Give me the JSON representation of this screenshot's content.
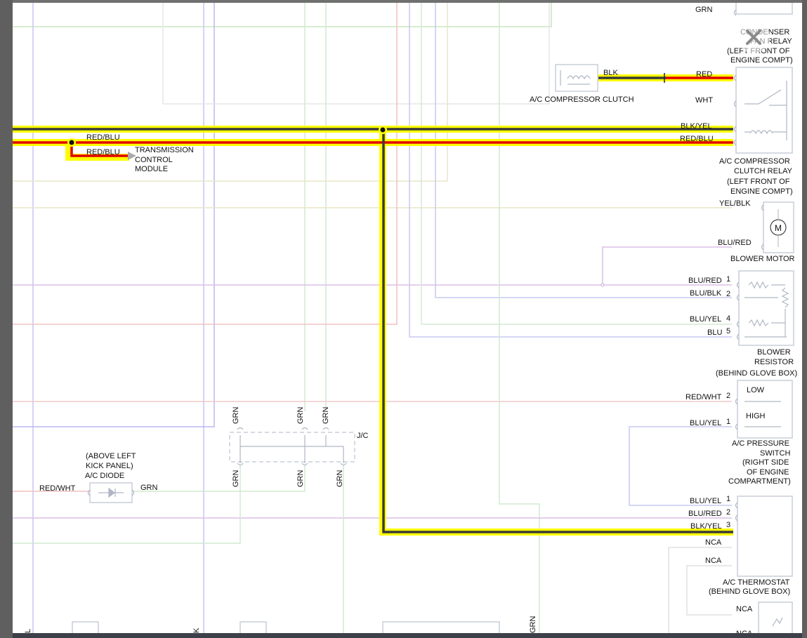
{
  "labels": {
    "grn_top": "GRN",
    "condenser_fan_relay": "CONDENSER",
    "condenser_fan_relay_2": "FAN RELAY",
    "condenser_loc_1": "(LEFT FRONT OF",
    "condenser_loc_2": "ENGINE COMPT)",
    "blk": "BLK",
    "red": "RED",
    "ac_compressor_clutch": "A/C COMPRESSOR CLUTCH",
    "wht": "WHT",
    "blk_yel_1": "BLK/YEL",
    "red_blu_1": "RED/BLU",
    "red_blu_left_1": "RED/BLU",
    "red_blu_left_2": "RED/BLU",
    "tcm_1": "TRANSMISSION",
    "tcm_2": "CONTROL",
    "tcm_3": "MODULE",
    "ac_clutch_relay_1": "A/C COMPRESSOR",
    "ac_clutch_relay_2": "CLUTCH RELAY",
    "ac_clutch_relay_3": "(LEFT FRONT OF",
    "ac_clutch_relay_4": "ENGINE COMPT)",
    "yel_blk": "YEL/BLK",
    "blu_red_motor": "BLU/RED",
    "blower_motor": "BLOWER MOTOR",
    "motor_m": "M",
    "res_blu_red": "BLU/RED",
    "res_blu_blk": "BLU/BLK",
    "res_blu_yel": "BLU/YEL",
    "res_blu": "BLU",
    "pin_1": "1",
    "pin_2": "2",
    "pin_4": "4",
    "pin_5": "5",
    "blower_resistor_1": "BLOWER",
    "blower_resistor_2": "RESISTOR",
    "blower_resistor_3": "(BEHIND GLOVE BOX)",
    "low": "LOW",
    "high": "HIGH",
    "ps_red_wht": "RED/WHT",
    "ps_blu_yel": "BLU/YEL",
    "ps_pin_2": "2",
    "ps_pin_1": "1",
    "ac_pressure_1": "A/C PRESSURE",
    "ac_pressure_2": "SWITCH",
    "ac_pressure_3": "(RIGHT SIDE",
    "ac_pressure_4": "OF ENGINE",
    "ac_pressure_5": "COMPARTMENT)",
    "jc": "J/C",
    "grn_jc_1": "GRN",
    "grn_jc_2": "GRN",
    "grn_jc_3": "GRN",
    "grn_jc_4": "GRN",
    "grn_jc_5": "GRN",
    "grn_jc_6": "GRN",
    "diode_loc_1": "(ABOVE LEFT",
    "diode_loc_2": "KICK PANEL)",
    "ac_diode": "A/C DIODE",
    "diode_red_wht": "RED/WHT",
    "diode_grn": "GRN",
    "th_blu_yel": "BLU/YEL",
    "th_blu_red": "BLU/RED",
    "th_blk_yel": "BLK/YEL",
    "th_pin_1": "1",
    "th_pin_2": "2",
    "th_pin_3": "3",
    "nca_1": "NCA",
    "nca_2": "NCA",
    "nca_3": "NCA",
    "nca_4": "NCA",
    "ac_thermostat_1": "A/C THERMOSTAT",
    "ac_thermostat_2": "(BEHIND GLOVE BOX)",
    "bottom_l": "L",
    "bottom_k": "K",
    "bottom_grn": "GRN"
  },
  "colors": {
    "highlight": "#ffff00",
    "wire_red": "#e00000",
    "wire_blk": "#3a3a3a",
    "faint_green": "#b9ddb0",
    "faint_red": "#f2b0b0",
    "faint_blue": "#b8b8f0",
    "faint_purple": "#d8b8e0"
  }
}
